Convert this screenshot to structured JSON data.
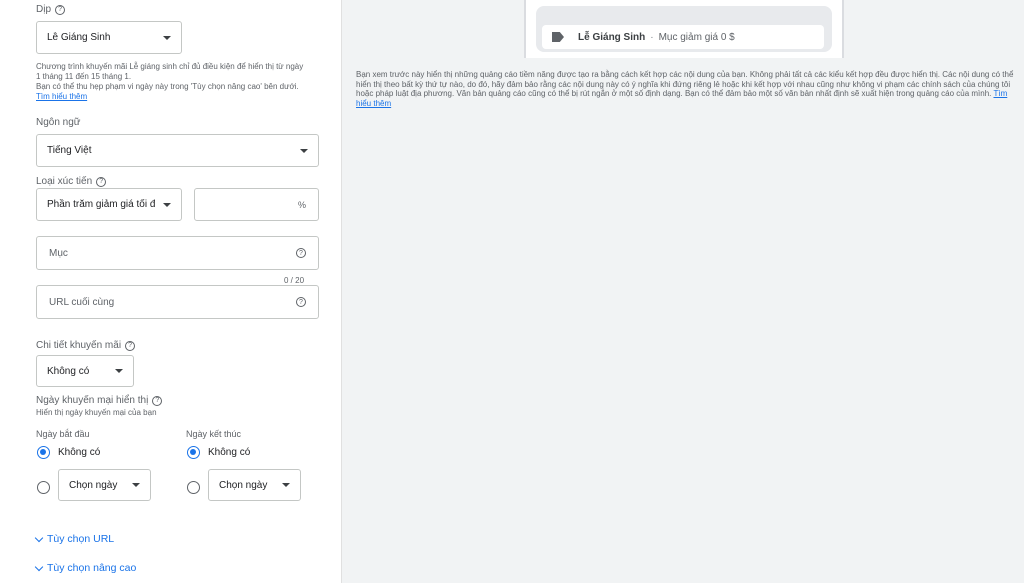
{
  "occasion": {
    "label": "Dịp",
    "selected": "Lễ Giáng Sinh",
    "info": "Chương trình khuyến mãi Lễ giáng sinh chỉ đủ điều kiện để hiển thị từ ngày 1 tháng 11 đến 15 tháng 1.",
    "info2": "Bạn có thể thu hẹp phạm vi ngày này trong 'Tùy chọn nâng cao' bên dưới.",
    "learn_more": "Tìm hiểu thêm"
  },
  "language": {
    "label": "Ngôn ngữ",
    "selected": "Tiếng Việt"
  },
  "promotion_type": {
    "label": "Loại xúc tiến",
    "selected": "Phần trăm giảm giá tối đa",
    "percent_suffix": "%"
  },
  "item": {
    "placeholder": "Mục",
    "counter": "0 / 20"
  },
  "final_url": {
    "placeholder": "URL cuối cùng"
  },
  "promo_details": {
    "label": "Chi tiết khuyến mãi",
    "selected": "Không có"
  },
  "display_dates": {
    "label": "Ngày khuyến mại hiển thị",
    "sub": "Hiển thị ngày khuyến mại của bạn",
    "start_label": "Ngày bắt đầu",
    "end_label": "Ngày kết thúc",
    "none_label": "Không có",
    "choose_date": "Chọn ngày"
  },
  "expanders": {
    "url_options": "Tùy chọn URL",
    "advanced_options": "Tùy chọn nâng cao"
  },
  "preview": {
    "title": "Lễ Giáng Sinh",
    "separator": "·",
    "subtitle": "Mục giảm giá 0 $"
  },
  "disclaimer": {
    "text": "Bạn xem trước này hiển thị những quảng cáo tiềm năng được tạo ra bằng cách kết hợp các nội dung của bạn. Không phải tất cả các kiểu kết hợp đều được hiển thị. Các nội dung có thể hiển thị theo bất kỳ thứ tự nào, do đó, hãy đảm bảo rằng các nội dung này có ý nghĩa khi đứng riêng lẻ hoặc khi kết hợp với nhau cũng như không vi phạm các chính sách của chúng tôi hoặc pháp luật địa phương. Văn bản quảng cáo cũng có thể bị rút ngắn ở một số định dạng. Bạn có thể đảm bảo một số văn bản nhất định sẽ xuất hiện trong quảng cáo của mình.",
    "learn_more": "Tìm hiểu thêm"
  },
  "colors": {
    "accent": "#1a73e8",
    "right_bg": "#f1f3f4"
  }
}
